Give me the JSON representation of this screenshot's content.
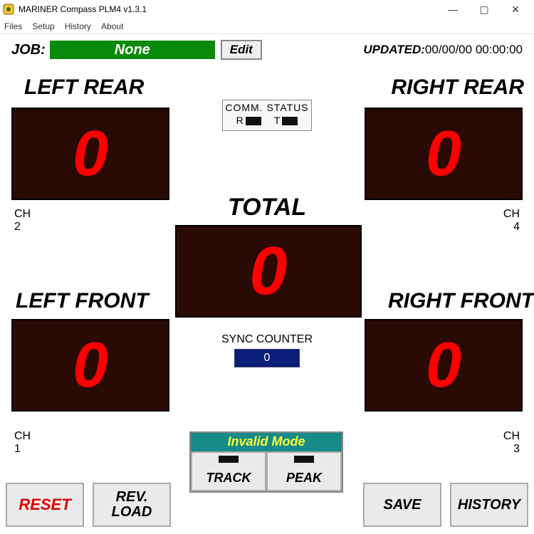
{
  "window": {
    "title": "MARINER Compass PLM4  v1.3.1"
  },
  "menu": {
    "files": "Files",
    "setup": "Setup",
    "history": "History",
    "about": "About"
  },
  "job": {
    "label": "JOB:",
    "value": "None",
    "edit": "Edit"
  },
  "updated": {
    "label": "UPDATED:",
    "value": "00/00/00 00:00:00"
  },
  "gauges": {
    "lr": {
      "title": "LEFT REAR",
      "value": "0",
      "ch_label": "CH",
      "ch_num": "2"
    },
    "rr": {
      "title": "RIGHT REAR",
      "value": "0",
      "ch_label": "CH",
      "ch_num": "4"
    },
    "lf": {
      "title": "LEFT FRONT",
      "value": "0",
      "ch_label": "CH",
      "ch_num": "1"
    },
    "rf": {
      "title": "RIGHT FRONT",
      "value": "0",
      "ch_label": "CH",
      "ch_num": "3"
    },
    "total": {
      "title": "TOTAL",
      "value": "0"
    }
  },
  "comm": {
    "title": "COMM. STATUS",
    "r": "R",
    "t": "T"
  },
  "sync": {
    "label": "SYNC COUNTER",
    "value": "0"
  },
  "mode": {
    "title": "Invalid Mode",
    "track": "TRACK",
    "peak": "PEAK"
  },
  "buttons": {
    "reset": "RESET",
    "revload": "REV.\nLOAD",
    "save": "SAVE",
    "history": "HISTORY"
  }
}
